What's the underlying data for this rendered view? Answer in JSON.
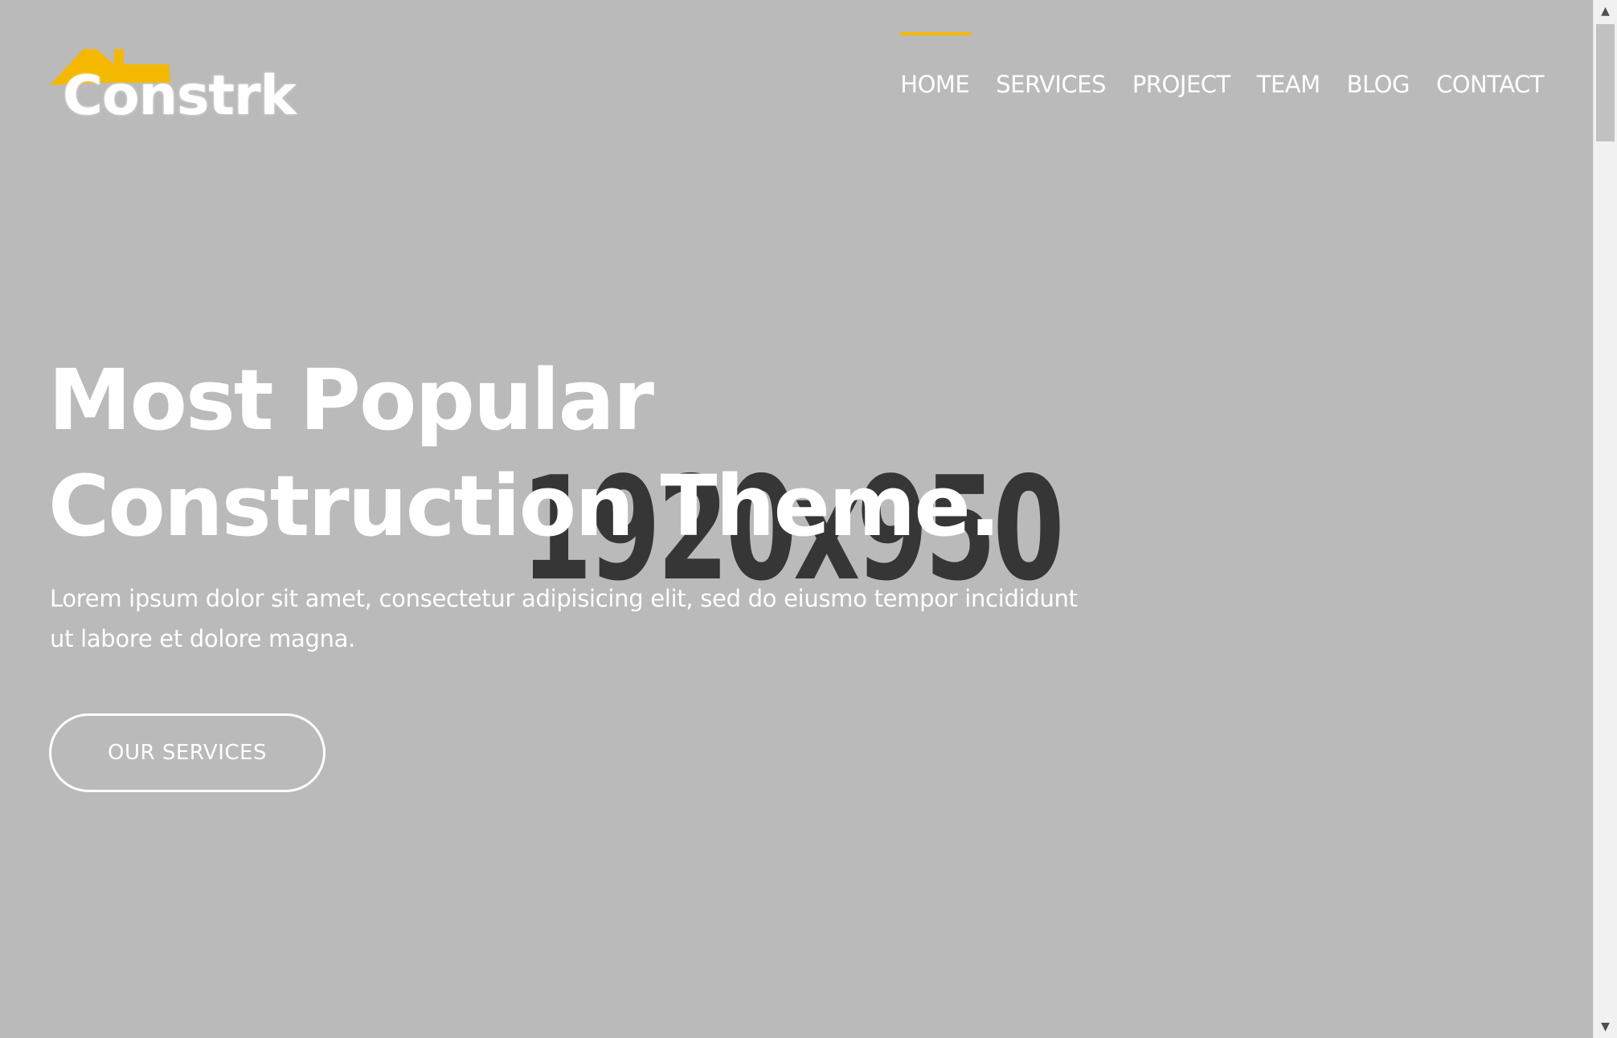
{
  "placeholder": {
    "label": "1920x950"
  },
  "logo": {
    "text": "Constrk",
    "roof_color": "#f5b800"
  },
  "nav": {
    "items": [
      {
        "label": "HOME",
        "active": true
      },
      {
        "label": "SERVICES",
        "active": false
      },
      {
        "label": "PROJECT",
        "active": false
      },
      {
        "label": "TEAM",
        "active": false
      },
      {
        "label": "BLOG",
        "active": false
      },
      {
        "label": "CONTACT",
        "active": false
      }
    ],
    "accent_color": "#f5b800"
  },
  "hero": {
    "title_line1": "Most Popular",
    "title_line2": "Construction Theme.",
    "subtitle": "Lorem ipsum dolor sit amet, consectetur adipisicing elit, sed do eiusmo tempor incididunt ut labore et dolore magna.",
    "cta_label": "OUR SERVICES"
  },
  "scrollbar": {
    "up_icon": "triangle-up",
    "down_icon": "triangle-down"
  }
}
